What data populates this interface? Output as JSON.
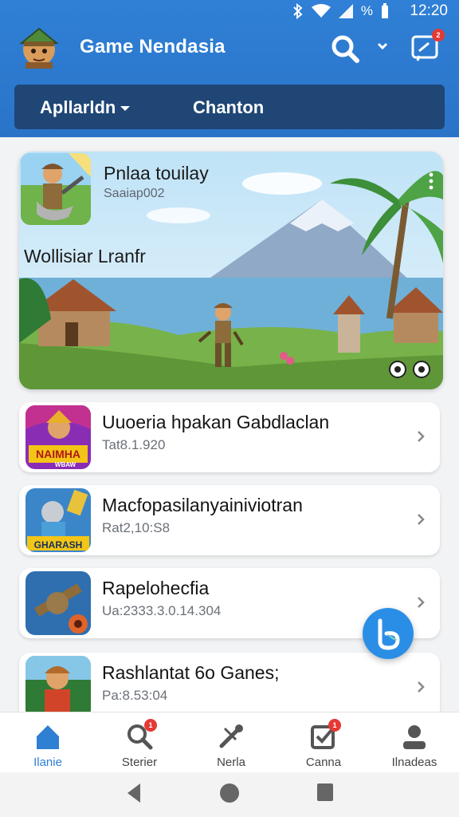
{
  "status_bar": {
    "battery_pct": "%",
    "time": "12:20"
  },
  "app": {
    "title": "Game Nendasia"
  },
  "header": {
    "message_badge": "2"
  },
  "tabs": [
    {
      "label": "Apllarldn"
    },
    {
      "label": "Chanton"
    }
  ],
  "featured": {
    "title": "Pnlaa touilay",
    "subtitle": "Saaiap002",
    "section_title": "Wollisiar Lranfr"
  },
  "list": [
    {
      "title": "Uuoeria hpakan Gabdlaclan",
      "subtitle": "Tat8.1.920",
      "icon_text": "NAIMHA",
      "icon_subtext": "WBAW"
    },
    {
      "title": "Macfopasilanyainiviotran",
      "subtitle": "Rat2,10:S8",
      "icon_text": "GHARASH"
    },
    {
      "title": "Rapelohecfia",
      "subtitle": "Ua:2333.3.0.14.304"
    },
    {
      "title": "Rashlantat 6o Ganes;",
      "subtitle": "Pa:8.53:04"
    }
  ],
  "bottom_nav": [
    {
      "label": "Ilanie",
      "icon": "home-icon"
    },
    {
      "label": "Sterier",
      "icon": "search-icon"
    },
    {
      "label": "Nerla",
      "icon": "tools-icon"
    },
    {
      "label": "Canna",
      "icon": "checkbox-icon"
    },
    {
      "label": "Ilnadeas",
      "icon": "profile-icon"
    }
  ],
  "nav_badges": {
    "search": "1",
    "canna": "1"
  },
  "colors": {
    "primary": "#2f80d6",
    "tab_bar": "#1f4675",
    "accent": "#2b8ee6"
  }
}
